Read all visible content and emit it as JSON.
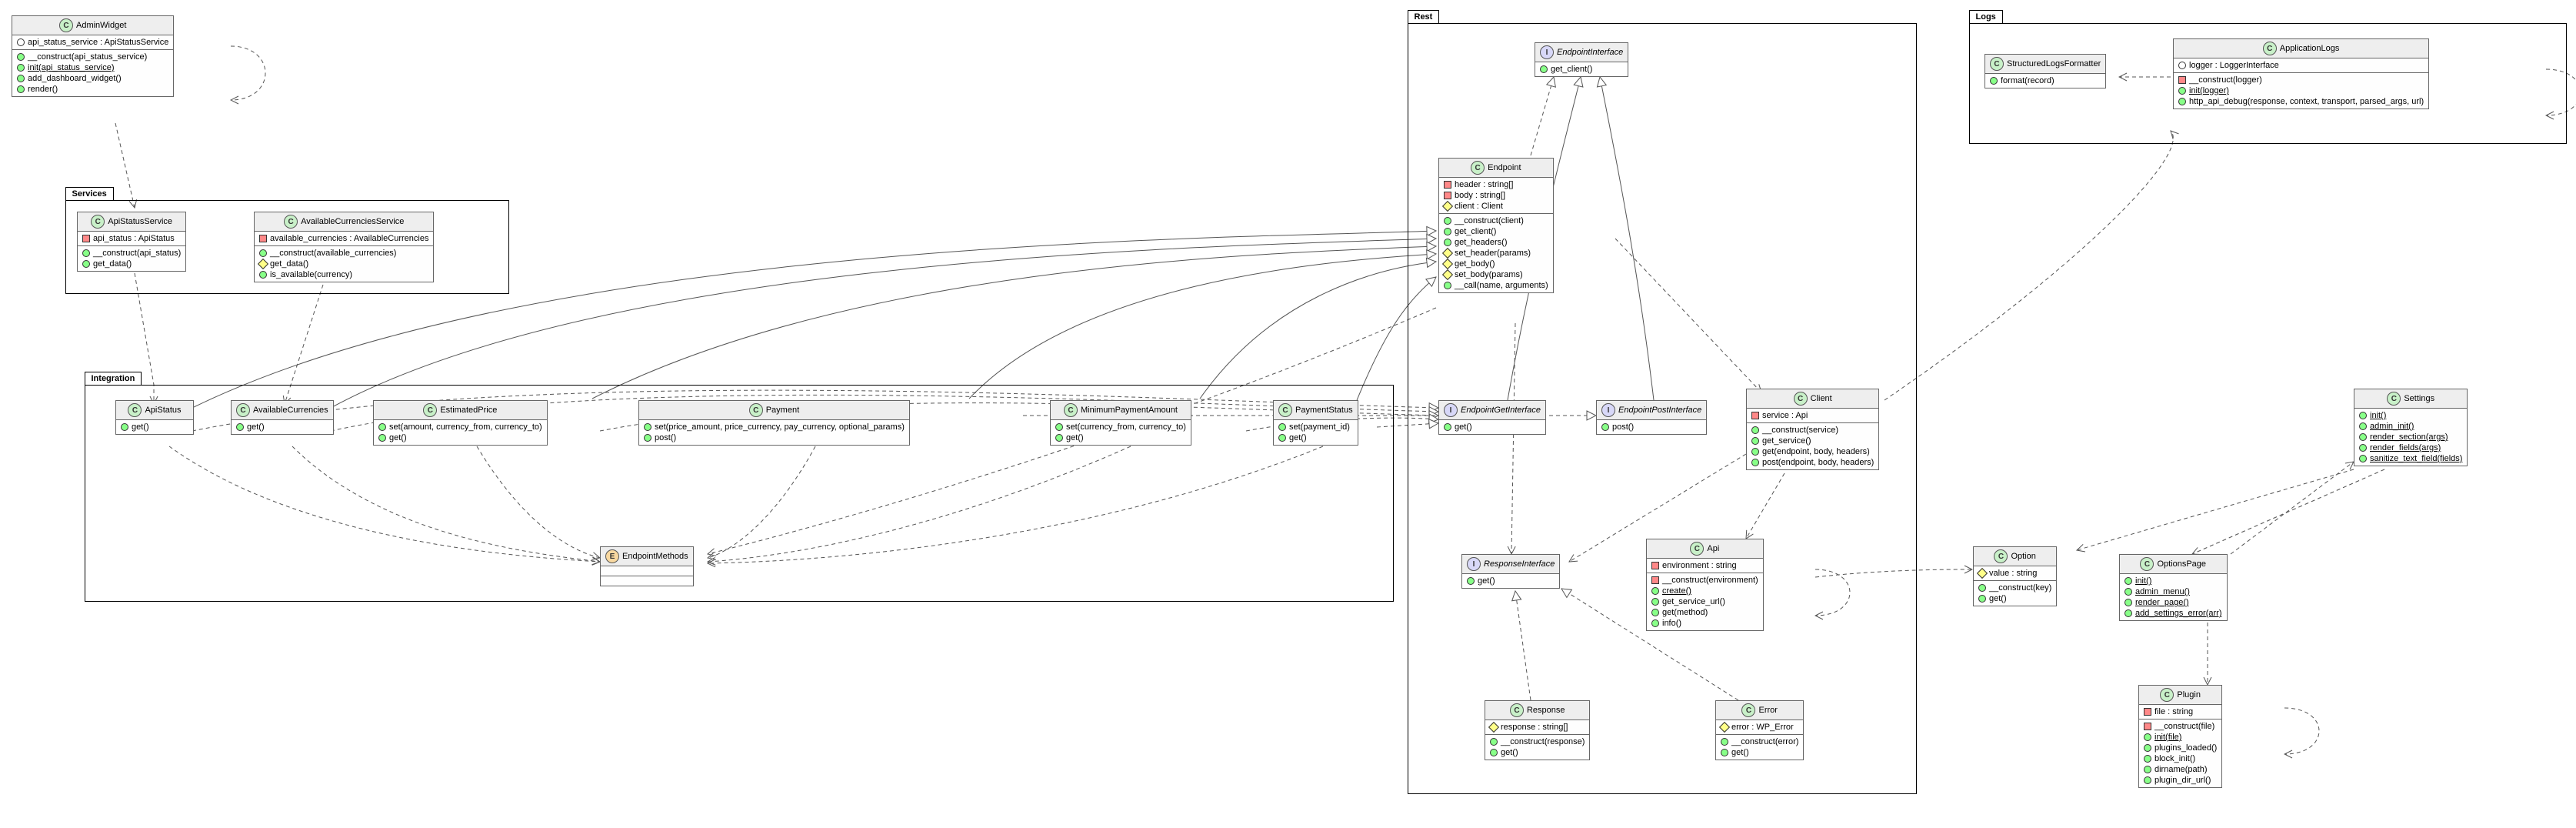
{
  "packages": {
    "services": {
      "label": "Services"
    },
    "integration": {
      "label": "Integration"
    },
    "rest": {
      "label": "Rest"
    },
    "logs": {
      "label": "Logs"
    }
  },
  "classes": {
    "AdminWidget": {
      "stereotype": "C",
      "name": "AdminWidget",
      "attrs": [
        {
          "vis": "package",
          "text": "api_status_service : ApiStatusService"
        }
      ],
      "ops": [
        {
          "vis": "public",
          "text": "__construct(api_status_service)"
        },
        {
          "vis": "public",
          "text": "init(api_status_service)",
          "underline": true
        },
        {
          "vis": "public",
          "text": "add_dashboard_widget()"
        },
        {
          "vis": "public",
          "text": "render()"
        }
      ]
    },
    "ApiStatusService": {
      "stereotype": "C",
      "name": "ApiStatusService",
      "attrs": [
        {
          "vis": "private",
          "text": "api_status : ApiStatus"
        }
      ],
      "ops": [
        {
          "vis": "public",
          "text": "__construct(api_status)"
        },
        {
          "vis": "public",
          "text": "get_data()"
        }
      ]
    },
    "AvailableCurrenciesService": {
      "stereotype": "C",
      "name": "AvailableCurrenciesService",
      "attrs": [
        {
          "vis": "private",
          "text": "available_currencies : AvailableCurrencies"
        }
      ],
      "ops": [
        {
          "vis": "public",
          "text": "__construct(available_currencies)"
        },
        {
          "vis": "protected",
          "text": "get_data()"
        },
        {
          "vis": "public",
          "text": "is_available(currency)"
        }
      ]
    },
    "ApiStatus": {
      "stereotype": "C",
      "name": "ApiStatus",
      "ops": [
        {
          "vis": "public",
          "text": "get()"
        }
      ]
    },
    "AvailableCurrencies": {
      "stereotype": "C",
      "name": "AvailableCurrencies",
      "ops": [
        {
          "vis": "public",
          "text": "get()"
        }
      ]
    },
    "EstimatedPrice": {
      "stereotype": "C",
      "name": "EstimatedPrice",
      "ops": [
        {
          "vis": "public",
          "text": "set(amount, currency_from, currency_to)"
        },
        {
          "vis": "public",
          "text": "get()"
        }
      ]
    },
    "Payment": {
      "stereotype": "C",
      "name": "Payment",
      "ops": [
        {
          "vis": "public",
          "text": "set(price_amount, price_currency, pay_currency, optional_params)"
        },
        {
          "vis": "public",
          "text": "post()"
        }
      ]
    },
    "MinimumPaymentAmount": {
      "stereotype": "C",
      "name": "MinimumPaymentAmount",
      "ops": [
        {
          "vis": "public",
          "text": "set(currency_from, currency_to)"
        },
        {
          "vis": "public",
          "text": "get()"
        }
      ]
    },
    "PaymentStatus": {
      "stereotype": "C",
      "name": "PaymentStatus",
      "ops": [
        {
          "vis": "public",
          "text": "set(payment_id)"
        },
        {
          "vis": "public",
          "text": "get()"
        }
      ]
    },
    "EndpointMethods": {
      "stereotype": "E",
      "name": "EndpointMethods",
      "ops": []
    },
    "EndpointInterface": {
      "stereotype": "I",
      "name": "EndpointInterface",
      "ops": [
        {
          "vis": "public",
          "text": "get_client()"
        }
      ]
    },
    "Endpoint": {
      "stereotype": "C",
      "name": "Endpoint",
      "attrs": [
        {
          "vis": "private",
          "text": "header : string[]"
        },
        {
          "vis": "private",
          "text": "body : string[]"
        },
        {
          "vis": "protected",
          "text": "client : Client"
        }
      ],
      "ops": [
        {
          "vis": "public",
          "text": "__construct(client)"
        },
        {
          "vis": "public",
          "text": "get_client()"
        },
        {
          "vis": "public",
          "text": "get_headers()"
        },
        {
          "vis": "protected",
          "text": "set_header(params)"
        },
        {
          "vis": "protected",
          "text": "get_body()"
        },
        {
          "vis": "protected",
          "text": "set_body(params)"
        },
        {
          "vis": "public",
          "text": "__call(name, arguments)"
        }
      ]
    },
    "EndpointGetInterface": {
      "stereotype": "I",
      "name": "EndpointGetInterface",
      "ops": [
        {
          "vis": "public",
          "text": "get()"
        }
      ]
    },
    "EndpointPostInterface": {
      "stereotype": "I",
      "name": "EndpointPostInterface",
      "ops": [
        {
          "vis": "public",
          "text": "post()"
        }
      ]
    },
    "Client": {
      "stereotype": "C",
      "name": "Client",
      "attrs": [
        {
          "vis": "private",
          "text": "service : Api"
        }
      ],
      "ops": [
        {
          "vis": "public",
          "text": "__construct(service)"
        },
        {
          "vis": "public",
          "text": "get_service()"
        },
        {
          "vis": "public",
          "text": "get(endpoint, body, headers)"
        },
        {
          "vis": "public",
          "text": "post(endpoint, body, headers)"
        }
      ]
    },
    "ResponseInterface": {
      "stereotype": "I",
      "name": "ResponseInterface",
      "ops": [
        {
          "vis": "public",
          "text": "get()"
        }
      ]
    },
    "Api": {
      "stereotype": "C",
      "name": "Api",
      "attrs": [
        {
          "vis": "private",
          "text": "environment : string"
        }
      ],
      "ops": [
        {
          "vis": "private",
          "text": "__construct(environment)"
        },
        {
          "vis": "public",
          "text": "create()",
          "underline": true
        },
        {
          "vis": "public",
          "text": "get_service_url()"
        },
        {
          "vis": "public",
          "text": "get(method)"
        },
        {
          "vis": "public",
          "text": "info()"
        }
      ]
    },
    "Response": {
      "stereotype": "C",
      "name": "Response",
      "attrs": [
        {
          "vis": "protected",
          "text": "response : string[]"
        }
      ],
      "ops": [
        {
          "vis": "public",
          "text": "__construct(response)"
        },
        {
          "vis": "public",
          "text": "get()"
        }
      ]
    },
    "Error": {
      "stereotype": "C",
      "name": "Error",
      "attrs": [
        {
          "vis": "protected",
          "text": "error : WP_Error"
        }
      ],
      "ops": [
        {
          "vis": "public",
          "text": "__construct(error)"
        },
        {
          "vis": "public",
          "text": "get()"
        }
      ]
    },
    "StructuredLogsFormatter": {
      "stereotype": "C",
      "name": "StructuredLogsFormatter",
      "ops": [
        {
          "vis": "public",
          "text": "format(record)"
        }
      ]
    },
    "ApplicationLogs": {
      "stereotype": "C",
      "name": "ApplicationLogs",
      "attrs": [
        {
          "vis": "package",
          "text": "logger : LoggerInterface"
        }
      ],
      "ops": [
        {
          "vis": "private",
          "text": "__construct(logger)"
        },
        {
          "vis": "public",
          "text": "init(logger)",
          "underline": true
        },
        {
          "vis": "public",
          "text": "http_api_debug(response, context, transport, parsed_args, url)"
        }
      ]
    },
    "Settings": {
      "stereotype": "C",
      "name": "Settings",
      "ops": [
        {
          "vis": "public",
          "text": "init()",
          "underline": true
        },
        {
          "vis": "public",
          "text": "admin_init()",
          "underline": true
        },
        {
          "vis": "public",
          "text": "render_section(args)",
          "underline": true
        },
        {
          "vis": "public",
          "text": "render_fields(args)",
          "underline": true
        },
        {
          "vis": "public",
          "text": "sanitize_text_field(fields)",
          "underline": true
        }
      ]
    },
    "Option": {
      "stereotype": "C",
      "name": "Option",
      "attrs": [
        {
          "vis": "protected",
          "text": "value : string"
        }
      ],
      "ops": [
        {
          "vis": "public",
          "text": "__construct(key)"
        },
        {
          "vis": "public",
          "text": "get()"
        }
      ]
    },
    "OptionsPage": {
      "stereotype": "C",
      "name": "OptionsPage",
      "ops": [
        {
          "vis": "public",
          "text": "init()",
          "underline": true
        },
        {
          "vis": "public",
          "text": "admin_menu()",
          "underline": true
        },
        {
          "vis": "public",
          "text": "render_page()",
          "underline": true
        },
        {
          "vis": "public",
          "text": "add_settings_error(arr)",
          "underline": true
        }
      ]
    },
    "Plugin": {
      "stereotype": "C",
      "name": "Plugin",
      "attrs": [
        {
          "vis": "private",
          "text": "file : string"
        }
      ],
      "ops": [
        {
          "vis": "private",
          "text": "__construct(file)"
        },
        {
          "vis": "public",
          "text": "init(file)",
          "underline": true
        },
        {
          "vis": "public",
          "text": "plugins_loaded()"
        },
        {
          "vis": "public",
          "text": "block_init()"
        },
        {
          "vis": "public",
          "text": "dirname(path)"
        },
        {
          "vis": "public",
          "text": "plugin_dir_url()"
        }
      ]
    }
  },
  "chart_data": {
    "type": "uml-class-diagram",
    "packages": [
      "Services",
      "Integration",
      "Rest",
      "Logs"
    ],
    "relationships": [
      {
        "from": "AdminWidget",
        "to": "AdminWidget",
        "type": "dependency",
        "self": true
      },
      {
        "from": "AdminWidget",
        "to": "ApiStatusService",
        "type": "dependency"
      },
      {
        "from": "ApiStatusService",
        "to": "ApiStatus",
        "type": "dependency"
      },
      {
        "from": "AvailableCurrenciesService",
        "to": "AvailableCurrencies",
        "type": "dependency"
      },
      {
        "from": "ApiStatus",
        "to": "Endpoint",
        "type": "generalization"
      },
      {
        "from": "AvailableCurrencies",
        "to": "Endpoint",
        "type": "generalization"
      },
      {
        "from": "EstimatedPrice",
        "to": "Endpoint",
        "type": "generalization"
      },
      {
        "from": "Payment",
        "to": "Endpoint",
        "type": "generalization"
      },
      {
        "from": "MinimumPaymentAmount",
        "to": "Endpoint",
        "type": "generalization"
      },
      {
        "from": "PaymentStatus",
        "to": "Endpoint",
        "type": "generalization"
      },
      {
        "from": "ApiStatus",
        "to": "EndpointGetInterface",
        "type": "realization"
      },
      {
        "from": "AvailableCurrencies",
        "to": "EndpointGetInterface",
        "type": "realization"
      },
      {
        "from": "EstimatedPrice",
        "to": "EndpointGetInterface",
        "type": "realization"
      },
      {
        "from": "MinimumPaymentAmount",
        "to": "EndpointGetInterface",
        "type": "realization"
      },
      {
        "from": "PaymentStatus",
        "to": "EndpointGetInterface",
        "type": "realization"
      },
      {
        "from": "Payment",
        "to": "EndpointPostInterface",
        "type": "realization"
      },
      {
        "from": "ApiStatus",
        "to": "EndpointMethods",
        "type": "dependency"
      },
      {
        "from": "AvailableCurrencies",
        "to": "EndpointMethods",
        "type": "dependency"
      },
      {
        "from": "EstimatedPrice",
        "to": "EndpointMethods",
        "type": "dependency"
      },
      {
        "from": "Payment",
        "to": "EndpointMethods",
        "type": "dependency"
      },
      {
        "from": "MinimumPaymentAmount",
        "to": "EndpointMethods",
        "type": "dependency"
      },
      {
        "from": "PaymentStatus",
        "to": "EndpointMethods",
        "type": "dependency"
      },
      {
        "from": "Endpoint",
        "to": "EndpointInterface",
        "type": "realization"
      },
      {
        "from": "Endpoint",
        "to": "Client",
        "type": "dependency"
      },
      {
        "from": "Endpoint",
        "to": "EndpointMethods",
        "type": "dependency"
      },
      {
        "from": "Endpoint",
        "to": "ResponseInterface",
        "type": "dependency"
      },
      {
        "from": "Client",
        "to": "Api",
        "type": "dependency"
      },
      {
        "from": "Client",
        "to": "ResponseInterface",
        "type": "dependency"
      },
      {
        "from": "Response",
        "to": "ResponseInterface",
        "type": "realization"
      },
      {
        "from": "Error",
        "to": "ResponseInterface",
        "type": "realization"
      },
      {
        "from": "Api",
        "to": "Api",
        "type": "dependency",
        "self": true
      },
      {
        "from": "Api",
        "to": "Option",
        "type": "dependency"
      },
      {
        "from": "Client",
        "to": "ApplicationLogs",
        "type": "dependency"
      },
      {
        "from": "Settings",
        "to": "Option",
        "type": "dependency"
      },
      {
        "from": "Settings",
        "to": "OptionsPage",
        "type": "dependency"
      },
      {
        "from": "OptionsPage",
        "to": "Settings",
        "type": "dependency"
      },
      {
        "from": "Plugin",
        "to": "Plugin",
        "type": "dependency",
        "self": true
      },
      {
        "from": "OptionsPage",
        "to": "Plugin",
        "type": "dependency"
      },
      {
        "from": "ApplicationLogs",
        "to": "StructuredLogsFormatter",
        "type": "dependency"
      },
      {
        "from": "ApplicationLogs",
        "to": "ApplicationLogs",
        "type": "dependency",
        "self": true
      }
    ]
  }
}
